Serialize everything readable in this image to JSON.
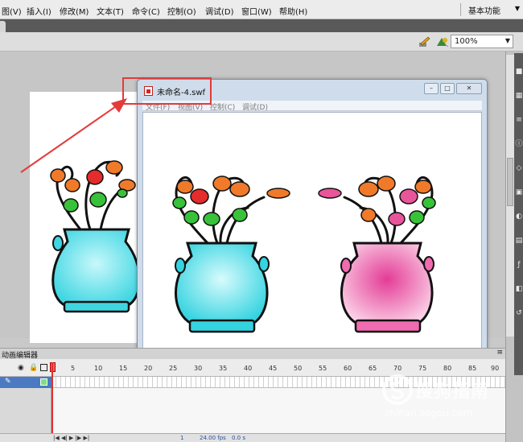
{
  "menubar": {
    "items": [
      "图(V)",
      "插入(I)",
      "修改(M)",
      "文本(T)",
      "命令(C)",
      "控制(O)",
      "调试(D)",
      "窗口(W)",
      "帮助(H)"
    ],
    "workspace": "基本功能"
  },
  "editbar": {
    "zoom": "100%"
  },
  "swf_window": {
    "title": "未命名-4.swf",
    "menu": [
      "文件(F)",
      "视图(V)",
      "控制(C)",
      "调试(D)"
    ],
    "btn_min": "–",
    "btn_max": "□",
    "btn_close": "✕"
  },
  "timeline": {
    "panel_title": "动画编辑器",
    "frame_numbers": [
      "5",
      "10",
      "15",
      "20",
      "25",
      "30",
      "35",
      "40",
      "45",
      "50",
      "55",
      "60",
      "65",
      "70",
      "75",
      "80",
      "85",
      "90"
    ],
    "fps": "24.00 fps",
    "time": "0.0 s",
    "current_frame": "1"
  },
  "watermark": {
    "text": "搜狗指南",
    "url": "zhinan.sogou.com"
  },
  "colors": {
    "annotation": "#e23b3b",
    "cyan_vase": "#5fe6ee",
    "pink_vase": "#f06bb0",
    "flower_orange": "#f07a2a",
    "flower_red": "#e52b2b",
    "flower_green": "#38c23a",
    "flower_pink": "#e8559a"
  }
}
